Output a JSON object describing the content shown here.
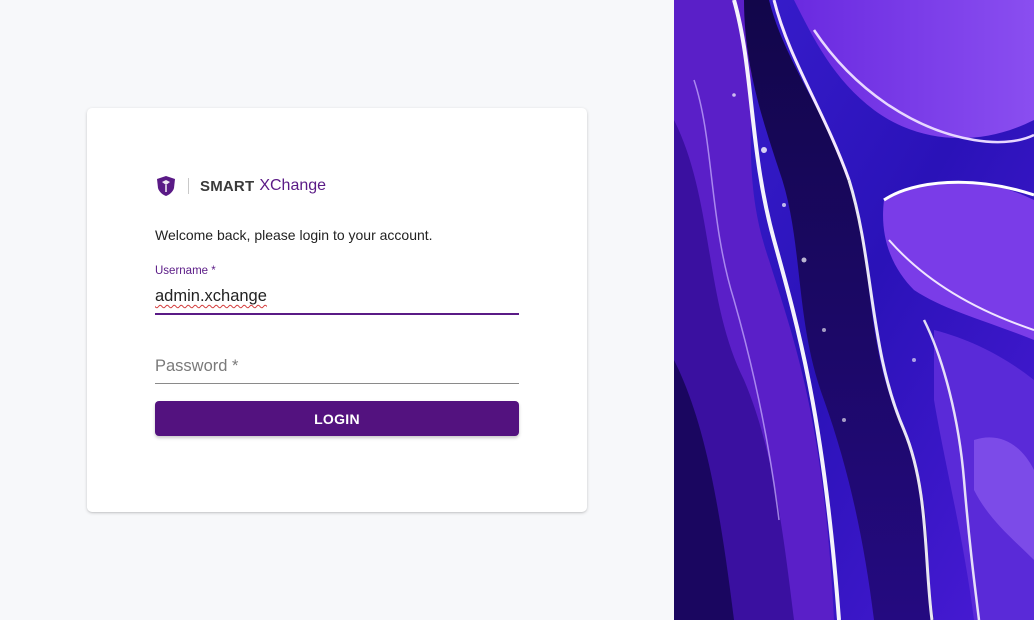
{
  "brand": {
    "icon": "shield-icon",
    "name_bold": "SMART",
    "name_light": "XChange",
    "accent_color": "#53127f"
  },
  "login": {
    "welcome_text": "Welcome back, please login to your account.",
    "username_label": "Username *",
    "username_value": "admin.xchange",
    "password_placeholder": "Password *",
    "button_label": "LOGIN"
  },
  "background": {
    "image": "purple-fluid-art"
  }
}
